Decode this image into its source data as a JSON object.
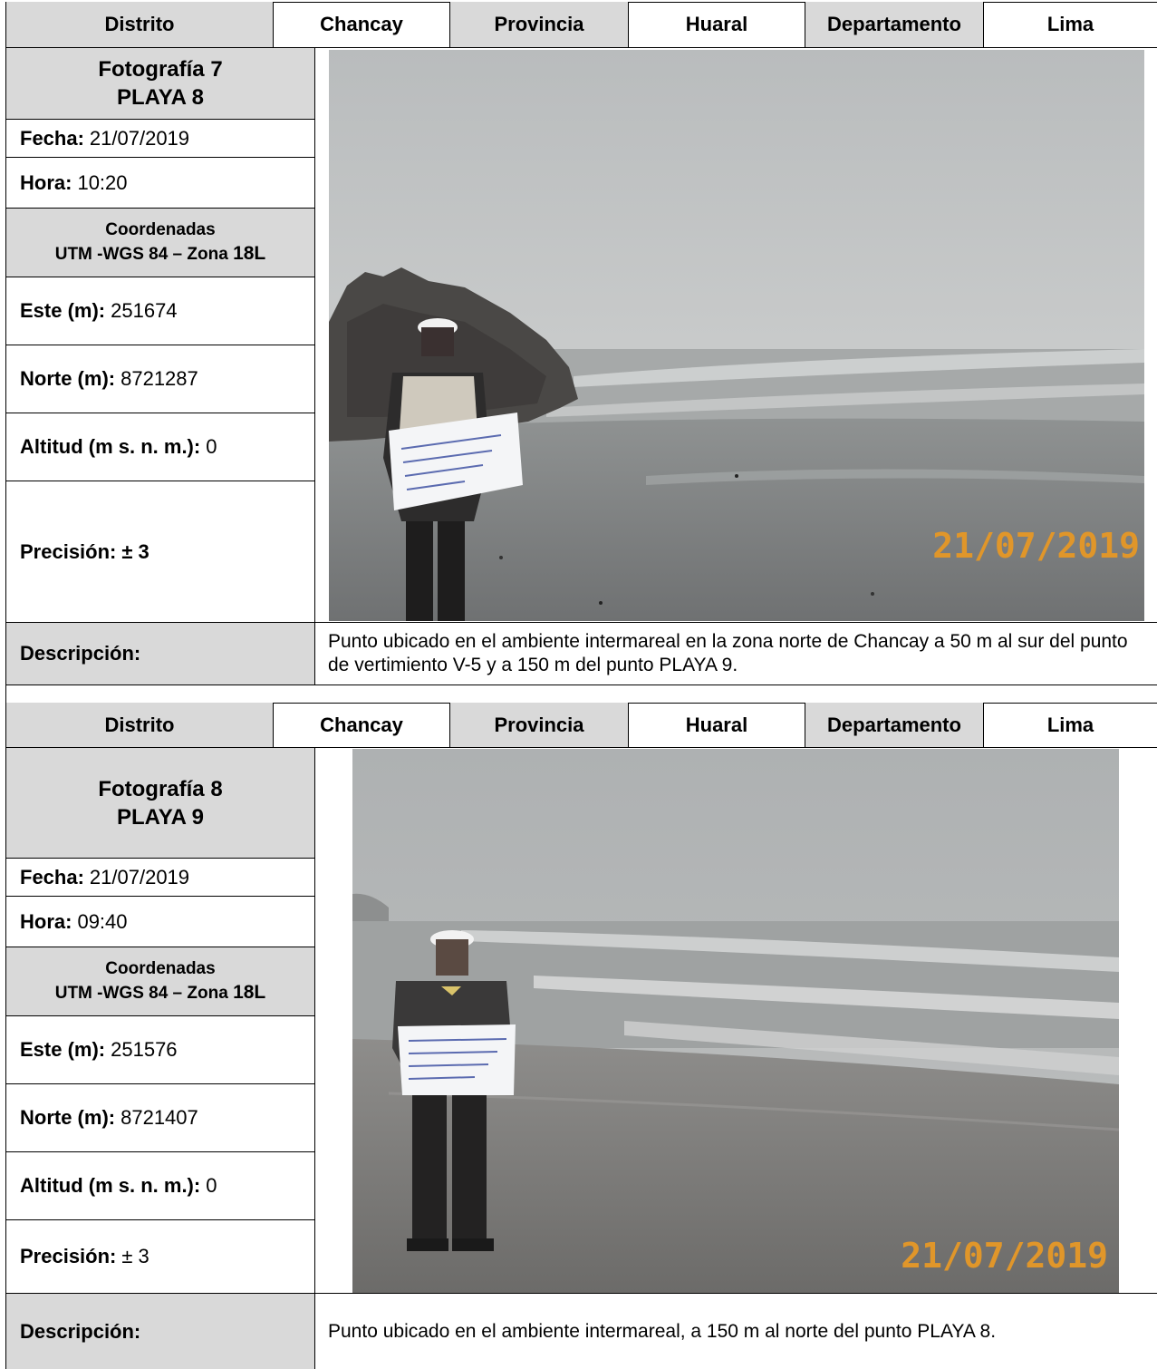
{
  "cards": [
    {
      "header": {
        "distrito_label": "Distrito",
        "distrito_value": "Chancay",
        "provincia_label": "Provincia",
        "provincia_value": "Huaral",
        "departamento_label": "Departamento",
        "departamento_value": "Lima"
      },
      "photo_title_line1": "Fotografía 7",
      "photo_title_line2": "PLAYA 8",
      "fecha_label": "Fecha:",
      "fecha_value": "21/07/2019",
      "hora_label": "Hora:",
      "hora_value": "10:20",
      "coord_line1": "Coordenadas",
      "coord_line2a": "UTM -WGS 84 – Zona",
      "coord_line2b": "18L",
      "este_label": "Este (m):",
      "este_value": "251674",
      "norte_label": "Norte (m):",
      "norte_value": "8721287",
      "altitud_label": "Altitud (m s. n. m.):",
      "altitud_value": "0",
      "precision_label": "Precisión:",
      "precision_value": "± 3",
      "photo_datestamp": "21/07/2019",
      "descripcion_label": "Descripción:",
      "descripcion_text": "Punto ubicado en el ambiente intermareal en la zona norte de Chancay a 50 m al sur del punto de vertimiento V-5 y a 150 m del punto PLAYA 9."
    },
    {
      "header": {
        "distrito_label": "Distrito",
        "distrito_value": "Chancay",
        "provincia_label": "Provincia",
        "provincia_value": "Huaral",
        "departamento_label": "Departamento",
        "departamento_value": "Lima"
      },
      "photo_title_line1": "Fotografía 8",
      "photo_title_line2": "PLAYA 9",
      "fecha_label": "Fecha:",
      "fecha_value": "21/07/2019",
      "hora_label": "Hora:",
      "hora_value": "09:40",
      "coord_line1": "Coordenadas",
      "coord_line2a": "UTM -WGS 84 – Zona",
      "coord_line2b": "18L",
      "este_label": "Este (m):",
      "este_value": "251576",
      "norte_label": "Norte (m):",
      "norte_value": "8721407",
      "altitud_label": "Altitud (m s. n. m.):",
      "altitud_value": "0",
      "precision_label": "Precisión:",
      "precision_value": "± 3",
      "photo_datestamp": "21/07/2019",
      "descripcion_label": "Descripción:",
      "descripcion_text": "Punto ubicado en el ambiente intermareal, a 150 m al norte del punto PLAYA 8."
    }
  ],
  "colors": {
    "label_gray": "#d9d9d9",
    "datestamp_orange": "#e0962a"
  }
}
